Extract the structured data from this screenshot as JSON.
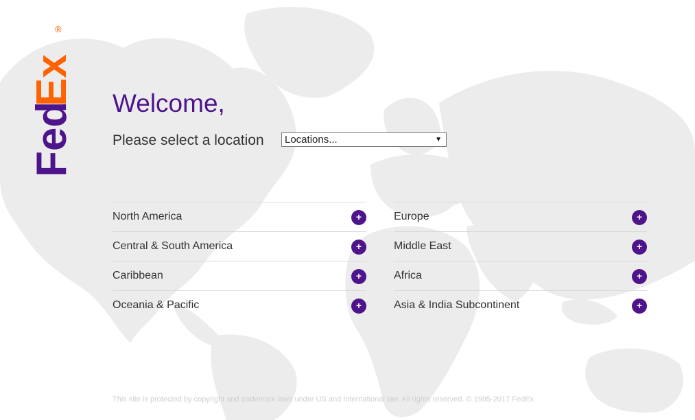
{
  "brand": {
    "logo_text_fed": "Fed",
    "logo_text_ex": "Ex",
    "logo_registered": "®",
    "purple": "#4d148c",
    "orange": "#ff6200"
  },
  "header": {
    "welcome": "Welcome,",
    "prompt": "Please select a location"
  },
  "location_select": {
    "selected": "Locations...",
    "arrow": "▼"
  },
  "regions": {
    "left": [
      {
        "label": "North America",
        "icon": "plus-icon",
        "symbol": "+"
      },
      {
        "label": "Central & South America",
        "icon": "plus-icon",
        "symbol": "+"
      },
      {
        "label": "Caribbean",
        "icon": "plus-icon",
        "symbol": "+"
      },
      {
        "label": "Oceania & Pacific",
        "icon": "plus-icon",
        "symbol": "+"
      }
    ],
    "right": [
      {
        "label": "Europe",
        "icon": "plus-icon",
        "symbol": "+"
      },
      {
        "label": "Middle East",
        "icon": "plus-icon",
        "symbol": "+"
      },
      {
        "label": "Africa",
        "icon": "plus-icon",
        "symbol": "+"
      },
      {
        "label": "Asia & India Subcontinent",
        "icon": "plus-icon",
        "symbol": "+"
      }
    ]
  },
  "footer": {
    "copyright": "This site is protected by copyright and trademark laws under US and International law. All rights reserved. © 1995-2017 FedEx"
  }
}
